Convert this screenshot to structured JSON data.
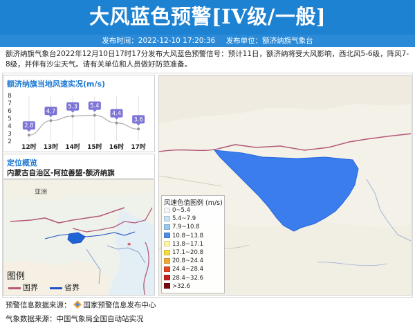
{
  "header": {
    "title": "大风蓝色预警[IV级/一般]",
    "publish_time_label": "发布时间：2022-12-10 17:20:36",
    "publisher_label": "发布单位：额济纳旗气象台",
    "bg_color": "#1e82d2"
  },
  "description": "额济纳旗气象台2022年12月10日17时17分发布大风蓝色预警信号：预计11日，额济纳将受大风影响，西北风5-6级，阵风7-8级，并伴有沙尘天气。请有关单位和人员做好防范准备。",
  "wind_panel": {
    "title": "额济纳旗当地风速实况(m/s)"
  },
  "chart_data": {
    "type": "line",
    "title": "额济纳旗当地风速实况(m/s)",
    "categories": [
      "12时",
      "13时",
      "14时",
      "15时",
      "16时",
      "17时"
    ],
    "values": [
      2.8,
      4.7,
      5.3,
      5.4,
      4.4,
      3.6
    ],
    "y_ticks": [
      "8",
      "7",
      "6",
      "5",
      "4",
      "3",
      "2"
    ],
    "ylim": [
      2,
      8
    ],
    "grid": true,
    "label_color": "#7b73d6"
  },
  "location": {
    "title": "定位概览",
    "path": "内蒙古自治区-阿拉善盟-额济纳旗",
    "map_label_asia": "亚洲"
  },
  "map_legend": {
    "title": "图例",
    "national_border": "国界",
    "provincial_border": "省界",
    "national_color": "#b45a78",
    "provincial_color": "#1e50c8"
  },
  "wind_legend": {
    "title": "风速色值图例 (m/s)",
    "items": [
      {
        "label": "0~5.4",
        "color": "#f5f5f5"
      },
      {
        "label": "5.4~7.9",
        "color": "#c8e1f5"
      },
      {
        "label": "7.9~10.8",
        "color": "#96c8f0"
      },
      {
        "label": "10.8~13.8",
        "color": "#4a8ce6"
      },
      {
        "label": "13.8~17.1",
        "color": "#fff5a0"
      },
      {
        "label": "17.1~20.8",
        "color": "#f5dc3c"
      },
      {
        "label": "20.8~24.4",
        "color": "#f0aa32"
      },
      {
        "label": "24.4~28.4",
        "color": "#e6461e"
      },
      {
        "label": "28.4~32.6",
        "color": "#c81e1e"
      },
      {
        "label": ">32.6",
        "color": "#7a0a0a"
      }
    ]
  },
  "footer": {
    "warning_source_label": "预警信息数据来源：",
    "warning_source_name": "国家预警信息发布中心",
    "weather_source_label": "气象数据来源：",
    "weather_source_name": "中国气象局全国自动站实况"
  }
}
